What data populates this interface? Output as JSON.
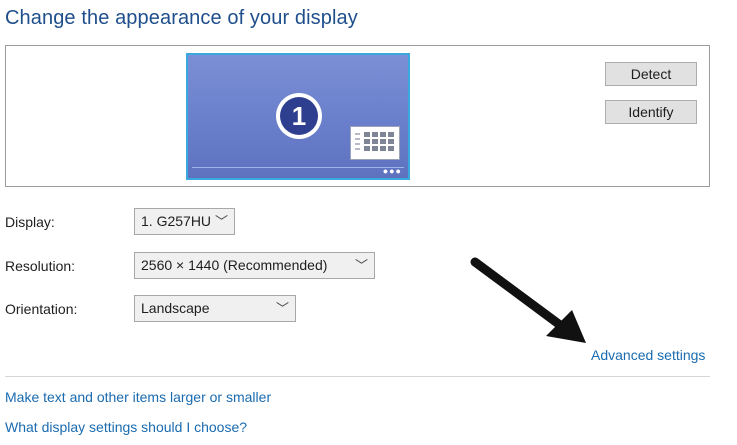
{
  "page": {
    "title": "Change the appearance of your display"
  },
  "preview": {
    "monitor_number": "1",
    "detect_label": "Detect",
    "identify_label": "Identify"
  },
  "settings": {
    "display": {
      "label": "Display:",
      "value": "1. G257HU"
    },
    "resolution": {
      "label": "Resolution:",
      "value": "2560 × 1440 (Recommended)"
    },
    "orientation": {
      "label": "Orientation:",
      "value": "Landscape"
    }
  },
  "links": {
    "advanced": "Advanced settings",
    "text_size": "Make text and other items larger or smaller",
    "which_settings": "What display settings should I choose?"
  },
  "icons": {
    "dropdown": "chevron-down-icon",
    "monitor": "monitor-icon",
    "annotation": "arrow-icon"
  },
  "colors": {
    "title": "#1e4e8c",
    "link": "#1a6bb0",
    "monitor_fill": "#6a7fcb",
    "monitor_border": "#3aa9dd"
  }
}
